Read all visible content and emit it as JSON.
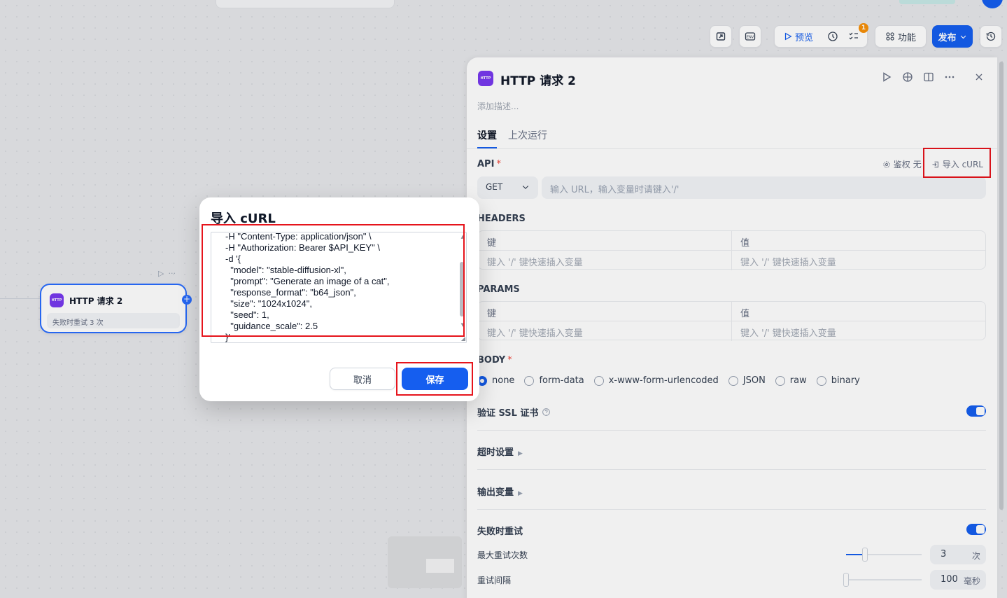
{
  "toolbar": {
    "preview_label": "预览",
    "features_label": "功能",
    "publish_label": "发布",
    "checklist_badge": "1",
    "env_label": "ENV"
  },
  "node": {
    "icon_text": "HTTP",
    "title": "HTTP 请求 2",
    "retry_text": "失败时重试 3 次"
  },
  "panel": {
    "icon_text": "HTTP",
    "title": "HTTP 请求 2",
    "description_placeholder": "添加描述...",
    "tabs": [
      {
        "label": "设置"
      },
      {
        "label": "上次运行"
      }
    ],
    "api": {
      "label": "API",
      "required_mark": "*",
      "auth_label": "鉴权",
      "auth_value": "无",
      "import_curl_label": "导入 cURL",
      "method": "GET",
      "url_placeholder": "输入 URL，输入变量时请键入'/'"
    },
    "headers": {
      "label": "HEADERS",
      "key_header": "键",
      "value_header": "值",
      "key_placeholder": "键入 '/' 键快速插入变量",
      "value_placeholder": "键入 '/' 键快速插入变量"
    },
    "params": {
      "label": "PARAMS",
      "key_header": "键",
      "value_header": "值",
      "key_placeholder": "键入 '/' 键快速插入变量",
      "value_placeholder": "键入 '/' 键快速插入变量"
    },
    "body": {
      "label": "BODY",
      "required_mark": "*",
      "options": [
        "none",
        "form-data",
        "x-www-form-urlencoded",
        "JSON",
        "raw",
        "binary"
      ],
      "selected": "none"
    },
    "ssl": {
      "label": "验证 SSL 证书",
      "enabled": true
    },
    "timeout_label": "超时设置",
    "output_vars_label": "输出变量",
    "retry": {
      "label": "失败时重试",
      "enabled": true,
      "max_retries_label": "最大重试次数",
      "max_retries_value": "3",
      "max_retries_unit": "次",
      "interval_label": "重试间隔",
      "interval_value": "100",
      "interval_unit": "毫秒"
    }
  },
  "modal": {
    "title": "导入 cURL",
    "code_lines": [
      "-H \"Content-Type: application/json\" \\",
      "-H \"Authorization: Bearer $API_KEY\" \\",
      "-d '{",
      "  \"model\": \"stable-diffusion-xl\",",
      "  \"prompt\": \"Generate an image of a cat\",",
      "  \"response_format\": \"b64_json\",",
      "  \"size\": \"1024x1024\",",
      "  \"seed\": 1,",
      "  \"guidance_scale\": 2.5",
      "}'"
    ],
    "cancel_label": "取消",
    "save_label": "保存"
  }
}
